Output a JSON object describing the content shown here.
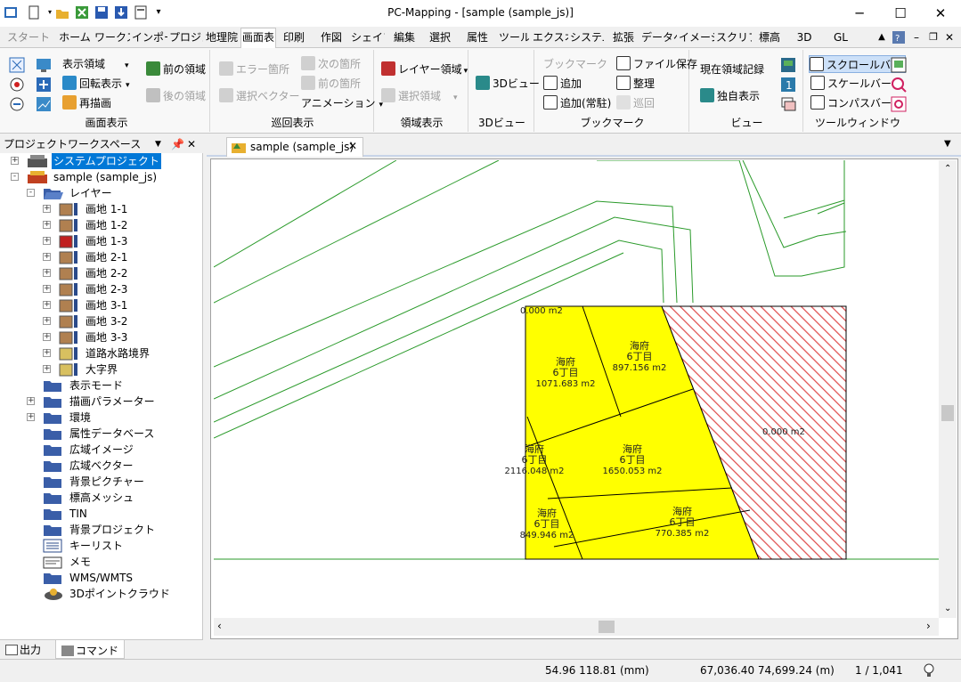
{
  "titlebar": {
    "title": "PC-Mapping - [sample (sample_js)]",
    "minimize": "─",
    "maximize": "☐",
    "close": "✕"
  },
  "tabs": [
    "スタート",
    "ホーム",
    "ワークス",
    "インポー",
    "プロジェ",
    "地理院",
    "画面表",
    "印刷",
    "作図",
    "シェイプ",
    "編集",
    "選択",
    "属性",
    "ツール",
    "エクスオ",
    "システム",
    "拡張",
    "データへ",
    "イメージ",
    "スクリプ",
    "標高",
    "3D",
    "GL"
  ],
  "active_tab": "画面表",
  "ribbon": {
    "display": {
      "label": "画面表示",
      "area": "表示領域",
      "rotate": "回転表示",
      "redraw": "再描画",
      "prev_area": "前の領域",
      "next_area": "後の領域"
    },
    "patrol": {
      "label": "巡回表示",
      "error": "エラー箇所",
      "select_vector": "選択ベクター",
      "next": "次の箇所",
      "prev": "前の箇所",
      "animation": "アニメーション"
    },
    "region": {
      "label": "領域表示",
      "layer_region": "レイヤー領域",
      "select_region": "選択領域"
    },
    "view3d": {
      "label": "3Dビュー",
      "btn": "3Dビュー"
    },
    "bookmark": {
      "label": "ブックマーク",
      "bookmark": "ブックマーク",
      "add": "追加",
      "add_resident": "追加(常駐)",
      "file_save": "ファイル保存",
      "organize": "整理",
      "patrol": "巡回"
    },
    "view": {
      "label": "ビュー",
      "record": "現在領域記録",
      "solo": "独自表示"
    },
    "toolwindow": {
      "label": "ツールウィンドウ",
      "scrollbar": "スクロールバー",
      "scalebar": "スケールバー",
      "compass": "コンパスバー"
    }
  },
  "project_panel": {
    "title": "プロジェクトワークスペース",
    "system_project": "システムプロジェクト",
    "project": "sample (sample_js)",
    "layer_folder": "レイヤー",
    "layers": [
      "画地 1-1",
      "画地 1-2",
      "画地 1-3",
      "画地 2-1",
      "画地 2-2",
      "画地 2-3",
      "画地 3-1",
      "画地 3-2",
      "画地 3-3",
      "道路水路境界",
      "大字界"
    ],
    "folders": [
      "表示モード",
      "描画パラメーター",
      "環境",
      "属性データベース",
      "広域イメージ",
      "広域ベクター",
      "背景ピクチャー",
      "標高メッシュ",
      "TIN",
      "背景プロジェクト",
      "キーリスト",
      "メモ",
      "WMS/WMTS",
      "3Dポイントクラウド"
    ]
  },
  "bottom_tabs": [
    "出力",
    "コマンド"
  ],
  "doc_tab": "sample (sample_js)",
  "map": {
    "parcels": [
      {
        "name": "海府",
        "sub": "6丁目",
        "area": "1071.683 m2"
      },
      {
        "name": "海府",
        "sub": "6丁目",
        "area": "897.156 m2"
      },
      {
        "name": "海府",
        "sub": "6丁目",
        "area": "2116.048 m2"
      },
      {
        "name": "海府",
        "sub": "6丁目",
        "area": "1650.053 m2"
      },
      {
        "name": "海府",
        "sub": "6丁目",
        "area": "849.946 m2"
      },
      {
        "name": "海府",
        "sub": "6丁目",
        "area": "770.385 m2"
      }
    ],
    "zero_top": "0.000 m2",
    "zero_right": "0.000 m2",
    "colors": {
      "parcel_fill": "#ffff00",
      "hatch": "#e05050",
      "road_line": "#2a9a2a"
    }
  },
  "status": {
    "mm": "54.96 118.81 (mm)",
    "coord": "67,036.40 74,699.24 (m)",
    "page": "1 / 1,041"
  }
}
